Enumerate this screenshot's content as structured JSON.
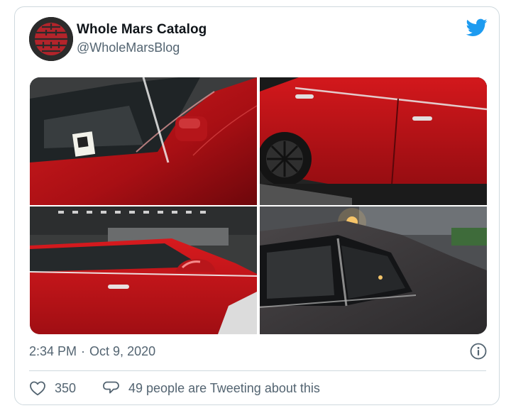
{
  "tweet": {
    "author": {
      "display_name": "Whole Mars Catalog",
      "handle": "@WholeMarsBlog",
      "avatar_icon": "mars-logo-avatar"
    },
    "brand_icon": "twitter-bird-icon",
    "brand_color": "#1d9bf0",
    "media": [
      {
        "icon": "red-car-interior-windshield-photo"
      },
      {
        "icon": "red-car-side-wheel-photo"
      },
      {
        "icon": "red-car-side-mirror-photo"
      },
      {
        "icon": "grey-car-rear-window-night-photo"
      }
    ],
    "time": "2:34 PM",
    "separator": "·",
    "date": "Oct 9, 2020",
    "info_icon": "info-icon",
    "likes": "350",
    "like_icon": "heart-icon",
    "reply_icon": "speech-bubble-icon",
    "conversation_text": "49 people are Tweeting about this",
    "colors": {
      "text": "#0f1419",
      "secondary": "#536471",
      "border": "#cfd9de",
      "car_red": "#c4141a",
      "car_grey": "#3d3a3e"
    }
  }
}
